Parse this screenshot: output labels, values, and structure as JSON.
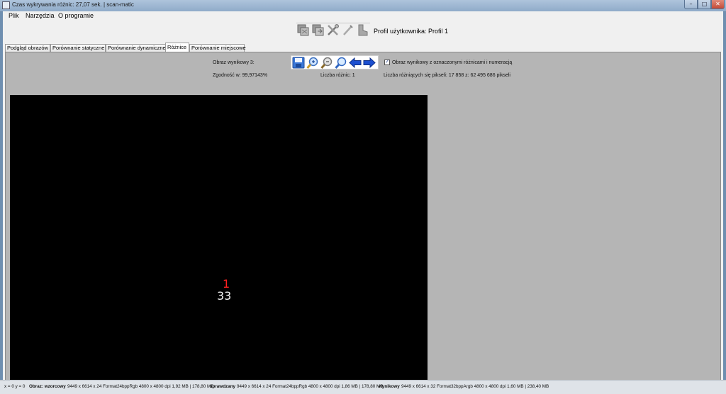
{
  "window": {
    "title": "Czas wykrywania różnic: 27,07 sek. | scan-matic",
    "min_glyph": "–",
    "max_glyph": "□",
    "close_glyph": "✕"
  },
  "menu": {
    "items": [
      {
        "label": "Plik"
      },
      {
        "label": "Narzędzia"
      },
      {
        "label": "O programie"
      }
    ]
  },
  "toolbar": {
    "icons": [
      "scan-compare-icon",
      "scan-export-icon",
      "tools-icon",
      "wand-icon",
      "profile-boot-icon"
    ],
    "profile_label": "Profil użytkownika: Profil 1"
  },
  "tabs": [
    {
      "label": "Podgląd obrazów",
      "active": false
    },
    {
      "label": "Porównanie statyczne",
      "active": false
    },
    {
      "label": "Porównanie dynamiczne",
      "active": false
    },
    {
      "label": "Różnice",
      "active": true
    },
    {
      "label": "Porównanie miejscowe",
      "active": false
    }
  ],
  "panel": {
    "result_image_label": "Obraz wynikowy 3:",
    "match_label": "Zgodność w: 99,97143%",
    "diff_count_label": "Liczba różnic: 1",
    "diff_pixels_label": "Liczba różniących się pikseli: 17 858 z: 62 495 686 pikseli",
    "checkbox_label": "Obraz wynikowy z oznaczonymi różnicami i numeracją",
    "checkbox_checked": true,
    "checkbox_glyph": "✓",
    "icons": [
      "save-icon",
      "zoom-in-icon",
      "zoom-out-icon",
      "zoom-icon",
      "arrow-left-icon",
      "arrow-right-icon"
    ]
  },
  "image": {
    "marker_number": "1",
    "marker_value": "33",
    "background": "#000000"
  },
  "status": {
    "coords": "x = 0   y = 0",
    "ref_label": "Obraz: wzorcowy",
    "ref_info": "9449 x 6614 x 24 Format24bppRgb 4800 x 4800 dpi 1,92 MB | 178,80 MB",
    "checked_label": "sprawdzany",
    "checked_info": "9449 x 6614 x 24 Format24bppRgb 4800 x 4800 dpi 1,86 MB | 178,80 MB",
    "result_label": "wynikowy",
    "result_info": "9449 x 6614 x 32 Format32bppArgb 4800 x 4800 dpi 1,60 MB | 238,40 MB"
  },
  "colors": {
    "panel_bg": "#b5b5b5",
    "marker_red": "#ff2020",
    "arrow_blue": "#1c4fd0"
  }
}
